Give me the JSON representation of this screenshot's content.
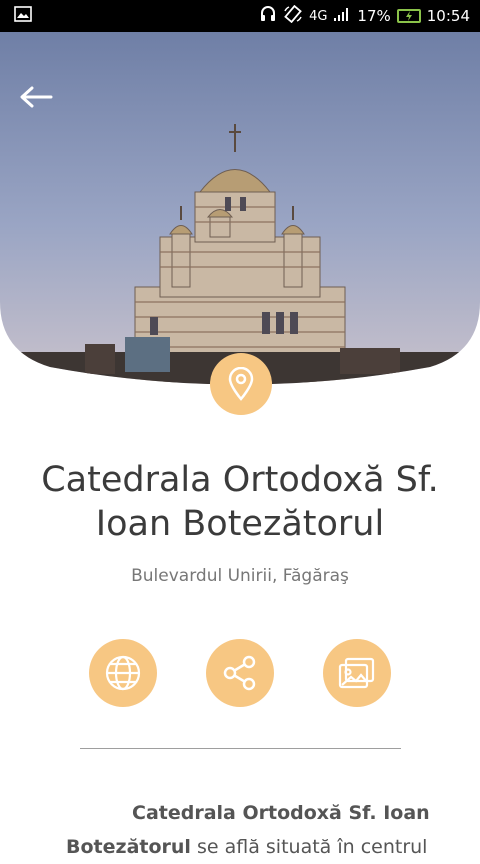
{
  "status_bar": {
    "network": "4G",
    "signal_icon": "signal-bars-icon",
    "battery": "17%",
    "time": "10:54",
    "icons": [
      "image-icon",
      "headphones-icon",
      "rotate-icon",
      "battery-charging-icon"
    ]
  },
  "hero": {
    "image": "church-photo",
    "back_icon": "arrow-left-icon",
    "pin_icon": "location-pin-icon"
  },
  "place": {
    "title_line1": "Catedrala Ortodoxă Sf.",
    "title_line2": "Ioan Botezătorul",
    "address": "Bulevardul Unirii, Făgăraş"
  },
  "actions": [
    {
      "icon": "globe-icon"
    },
    {
      "icon": "share-icon"
    },
    {
      "icon": "gallery-icon"
    }
  ],
  "description": {
    "bold": "Catedrala Ortodoxă Sf. Ioan Botezătorul",
    "text": " se află situată în centrul"
  },
  "colors": {
    "accent": "#f7c783",
    "title": "#3b3b3b",
    "address": "#777777"
  }
}
